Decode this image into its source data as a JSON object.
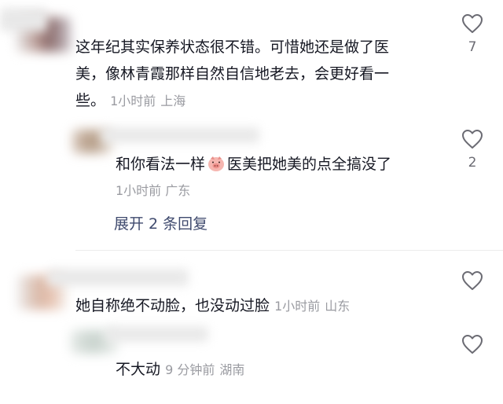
{
  "comments": [
    {
      "text_line1": "这年纪其实保养状态很不错。可惜她还是做了医",
      "text_line2": "美，像林青霞那样自然自信地老去，会更好看一",
      "text_line3": "些。",
      "time": "1小时前",
      "location": "上海",
      "likes": "7",
      "replies": [
        {
          "text_before_emoji": "和你看法一样",
          "emoji": "pig-face-emoji",
          "text_after_emoji": "医美把她美的点全搞没了",
          "time": "1小时前",
          "location": "广东",
          "likes": "2"
        }
      ],
      "expand_label": "展开 2 条回复"
    },
    {
      "text": "她自称绝不动脸，也没动过脸",
      "time": "1小时前",
      "location": "山东",
      "likes": "",
      "replies": [
        {
          "text": "不大动",
          "time": "9 分钟前",
          "location": "湖南",
          "likes": ""
        }
      ]
    }
  ],
  "icons": {
    "like": "heart-outline-icon"
  },
  "colors": {
    "text": "#161823",
    "meta": "#9a9ba1",
    "link": "#3f4a6e"
  }
}
